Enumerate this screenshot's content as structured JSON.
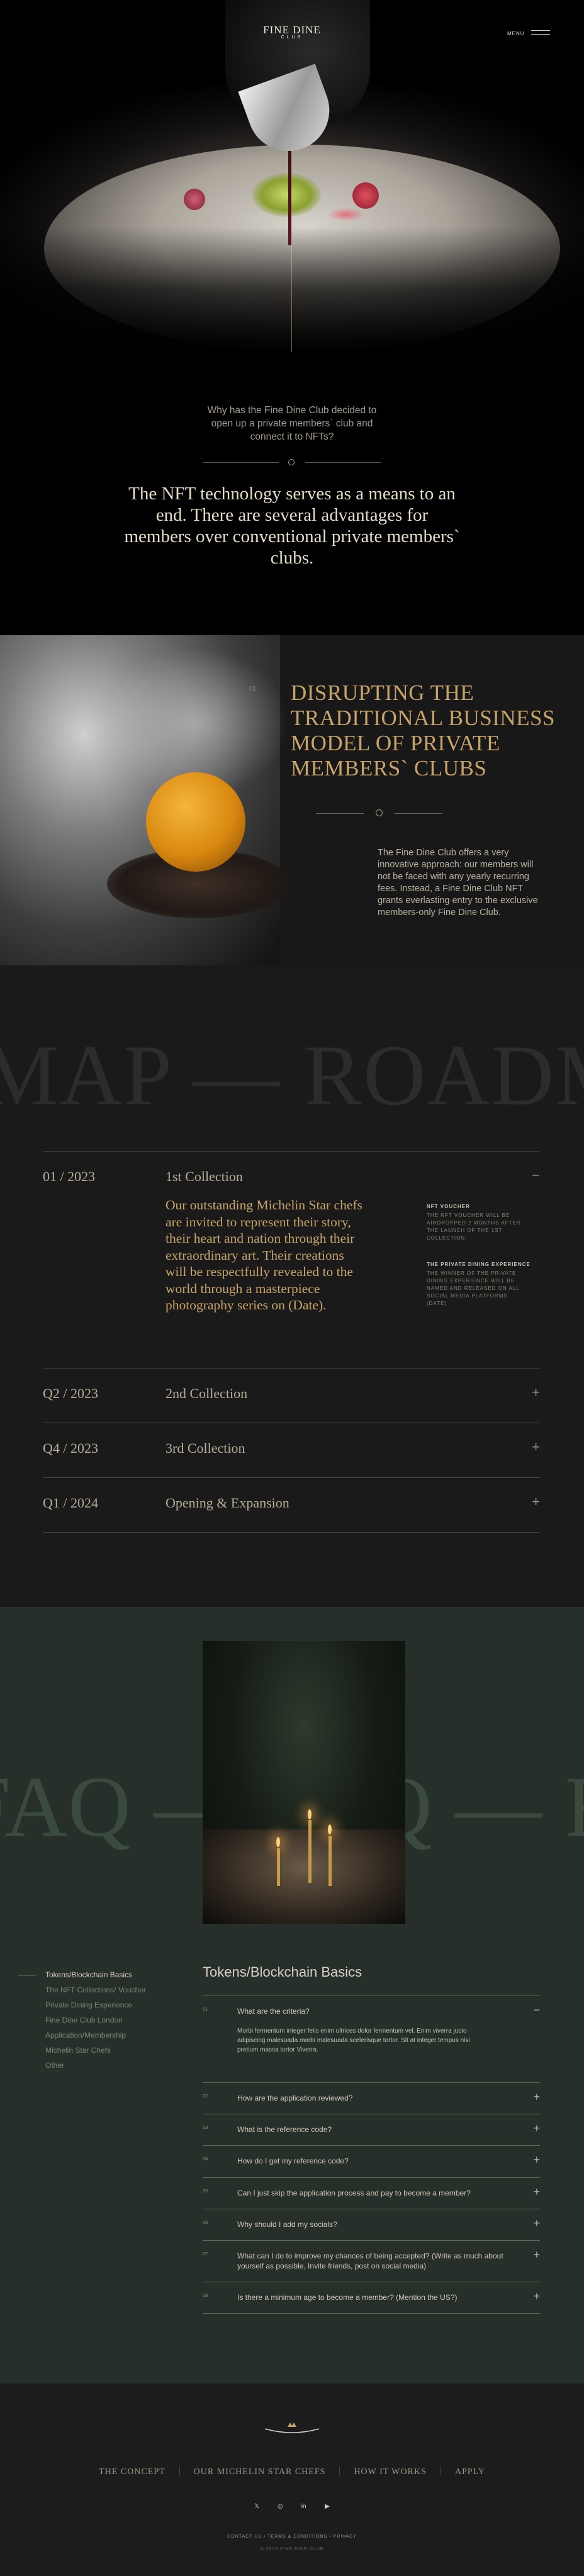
{
  "header": {
    "brand_line1": "FINE DINE",
    "brand_line2": "CLUB",
    "menu_label": "MENU"
  },
  "intro": {
    "question": "Why has the Fine Dine Club decided to open up a private members` club and connect it to NFTs?",
    "statement": "The NFT technology serves as a means to an end. There are several advantages for members over conventional private members` clubs."
  },
  "disrupt": {
    "number": "01",
    "heading": "DISRUPTING THE TRADITIONAL BUSINESS MODEL OF PRIVATE MEMBERS` CLUBS",
    "body": "The Fine Dine Club offers a very innovative approach: our members will not be faced with any yearly recurring fees. Instead, a Fine Dine Club NFT grants everlasting entry to the exclusive members-only Fine Dine Club."
  },
  "roadmap": {
    "watermark": "MAP — ROADMAP — ROADM",
    "items": [
      {
        "date": "01 / 2023",
        "title": "1st Collection",
        "toggle": "−",
        "description": "Our outstanding Michelin Star chefs are invited to represent their story, their heart and nation through their extraordinary art. Their creations will be respectfully revealed to the world through a masterpiece photography series on (Date).",
        "side": [
          {
            "heading": "NFT VOUCHER",
            "text": "THE NFT VOUCHER WILL BE AIRDROPPED 2 MONTHS AFTER THE LAUNCH OF THE 1ST COLLECTION."
          },
          {
            "heading": "THE PRIVATE DINING EXPERIENCE",
            "text": "THE WINNER OF THE PRIVATE DINING EXPERIENCE WILL BE NAMED AND RELEASED ON ALL SOCIAL MEDIA PLATFORMS (DATE)"
          }
        ]
      },
      {
        "date": "Q2 / 2023",
        "title": "2nd Collection",
        "toggle": "+"
      },
      {
        "date": "Q4 / 2023",
        "title": "3rd Collection",
        "toggle": "+"
      },
      {
        "date": "Q1 / 2024",
        "title": "Opening & Expansion",
        "toggle": "+"
      }
    ]
  },
  "faq": {
    "watermark": "FAQ — FAQ — FAQ — FAQ —",
    "categories": [
      "Tokens/Blockchain Basics",
      "The NFT Collections/ Voucher",
      "Private Dining Experience",
      "Fine Dine Club London",
      "Application/Membership",
      "Michelin Star Chefs",
      "Other"
    ],
    "section_title": "Tokens/Blockchain Basics",
    "questions": [
      {
        "num": "01",
        "q": "What are the criteria?",
        "toggle": "−",
        "a": "Morbi fermentum integer felis enim ultrices dolor fermentum vel. Enim viverra justo adipiscing malesuada morbi malesuada scelerisque tortor. Sit at integer tempus nisi pretium massa tortor Viverra."
      },
      {
        "num": "02",
        "q": "How are the application reviewed?",
        "toggle": "+"
      },
      {
        "num": "03",
        "q": "What is the reference code?",
        "toggle": "+"
      },
      {
        "num": "04",
        "q": "How do I get my reference code?",
        "toggle": "+"
      },
      {
        "num": "05",
        "q": "Can I just skip the application process and pay to become a member?",
        "toggle": "+"
      },
      {
        "num": "06",
        "q": "Why should I add my socials?",
        "toggle": "+"
      },
      {
        "num": "07",
        "q": "What can I do to improve my chances of being accepted? (Write as much about yourself as possible, Invite friends, post on social media)",
        "toggle": "+"
      },
      {
        "num": "08",
        "q": "Is there a minimum age to become a member? (Mention the US?)",
        "toggle": "+"
      }
    ]
  },
  "footer": {
    "nav": [
      "THE CONCEPT",
      "OUR MICHELIN STAR CHEFS",
      "HOW IT WORKS",
      "APPLY"
    ],
    "socials": [
      "twitter-icon",
      "instagram-icon",
      "linkedin-icon",
      "youtube-icon"
    ],
    "legal": "CONTACT US   •   TERMS & CONDITIONS   •   PRIVACY",
    "copyright": "© 2023 FINE DINE CLUB"
  },
  "colors": {
    "gold": "#c8a46a",
    "dark": "#1a1a1a",
    "forest": "#262f29"
  }
}
